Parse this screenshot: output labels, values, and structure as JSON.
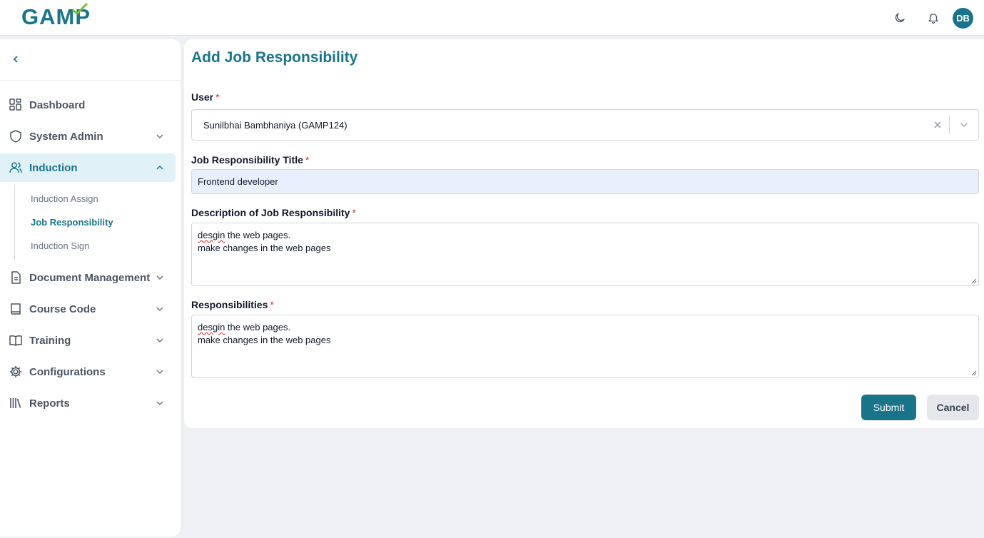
{
  "header": {
    "logo_text": "GAMP",
    "avatar_initials": "DB",
    "icons": [
      "moon-icon",
      "bell-icon"
    ]
  },
  "sidebar": {
    "items": [
      {
        "label": "Dashboard",
        "icon": "dashboard-icon"
      },
      {
        "label": "System Admin",
        "icon": "shield-icon"
      },
      {
        "label": "Induction",
        "icon": "users-icon",
        "active": true
      },
      {
        "label": "Document Management",
        "icon": "document-icon"
      },
      {
        "label": "Course Code",
        "icon": "book-icon"
      },
      {
        "label": "Training",
        "icon": "open-book-icon"
      },
      {
        "label": "Configurations",
        "icon": "gear-icon"
      },
      {
        "label": "Reports",
        "icon": "library-icon"
      }
    ],
    "induction_sub": [
      "Induction Assign",
      "Job Responsibility",
      "Induction Sign"
    ],
    "active_sub": "Job Responsibility"
  },
  "form": {
    "title": "Add Job Responsibility",
    "user_label": "User",
    "user_value": "Sunilbhai Bambhaniya (GAMP124)",
    "title_label": "Job Responsibility Title",
    "title_value": "Frontend developer",
    "description_label": "Description of Job Responsibility",
    "description_lines": [
      "desgin the web pages.",
      "make changes in the web pages"
    ],
    "responsibilities_label": "Responsibilities",
    "responsibilities_lines": [
      "desgin the web pages.",
      "make changes in the web pages"
    ],
    "required_mark": "*",
    "submit_label": "Submit",
    "cancel_label": "Cancel"
  },
  "colors": {
    "brand": "#1a7489",
    "active_bg": "#e0f2f7",
    "input_autofill": "#e8f0fd",
    "required": "#dc2626"
  }
}
